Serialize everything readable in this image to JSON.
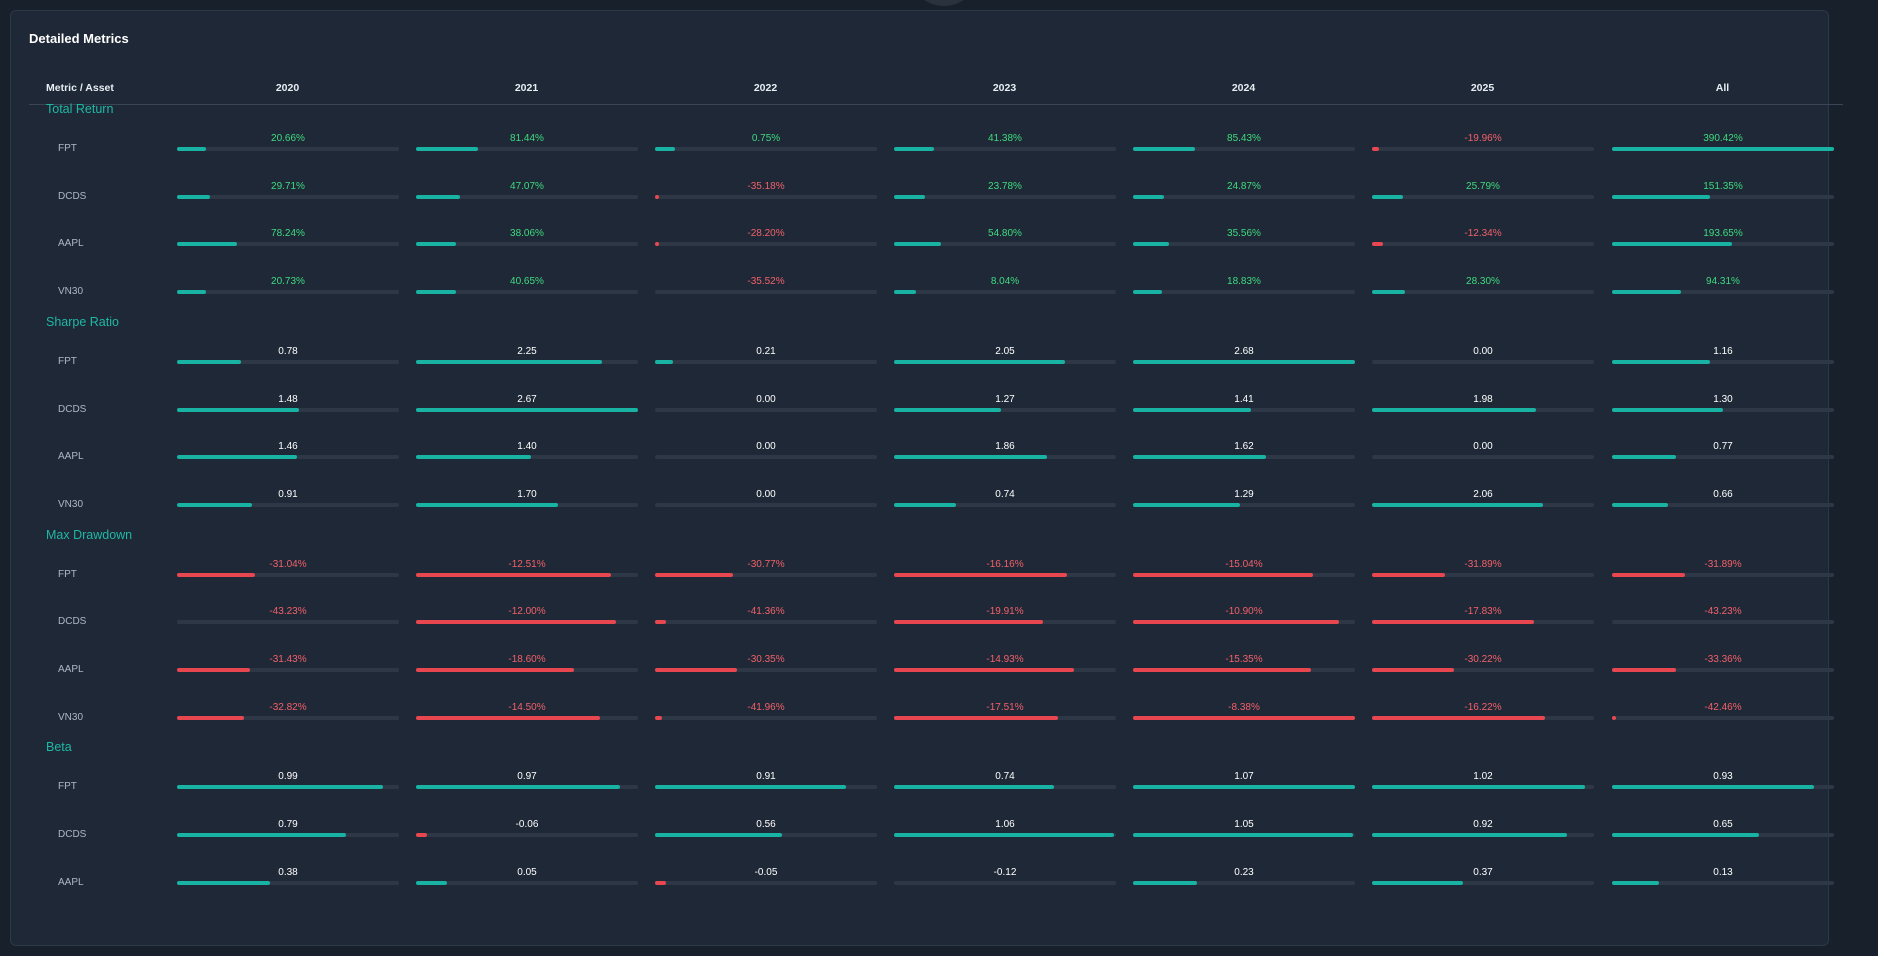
{
  "title": "Detailed Metrics",
  "columns": [
    "Metric / Asset",
    "2020",
    "2021",
    "2022",
    "2023",
    "2024",
    "2025",
    "All"
  ],
  "colors": {
    "positive": "#18b3a2",
    "negative": "#e84750",
    "text_green": "#3fdb7f",
    "text_red": "#f2616a",
    "section": "#1eb8a6"
  },
  "sections": [
    {
      "title": "Total Return",
      "rows": [
        {
          "asset": "FPT",
          "values": [
            "20.66%",
            "81.44%",
            "0.75%",
            "41.38%",
            "85.43%",
            "-19.96%",
            "390.42%"
          ],
          "bars": [
            0.13,
            0.28,
            0.09,
            0.18,
            0.28,
            0.03,
            1.0
          ],
          "signs": [
            "pos",
            "pos",
            "pos",
            "pos",
            "pos",
            "neg",
            "pos"
          ]
        },
        {
          "asset": "DCDS",
          "values": [
            "29.71%",
            "47.07%",
            "-35.18%",
            "23.78%",
            "24.87%",
            "25.79%",
            "151.35%"
          ],
          "bars": [
            0.15,
            0.2,
            0.005,
            0.14,
            0.14,
            0.14,
            0.44
          ],
          "signs": [
            "pos",
            "pos",
            "neg",
            "pos",
            "pos",
            "pos",
            "pos"
          ]
        },
        {
          "asset": "AAPL",
          "values": [
            "78.24%",
            "38.06%",
            "-28.20%",
            "54.80%",
            "35.56%",
            "-12.34%",
            "193.65%"
          ],
          "bars": [
            0.27,
            0.18,
            0.015,
            0.21,
            0.16,
            0.05,
            0.54
          ],
          "signs": [
            "pos",
            "pos",
            "neg",
            "pos",
            "pos",
            "neg",
            "pos"
          ]
        },
        {
          "asset": "VN30",
          "values": [
            "20.73%",
            "40.65%",
            "-35.52%",
            "8.04%",
            "18.83%",
            "28.30%",
            "94.31%"
          ],
          "bars": [
            0.13,
            0.18,
            0.0,
            0.1,
            0.13,
            0.15,
            0.31
          ],
          "signs": [
            "pos",
            "pos",
            "neg",
            "pos",
            "pos",
            "pos",
            "pos"
          ]
        }
      ]
    },
    {
      "title": "Sharpe Ratio",
      "rows": [
        {
          "asset": "FPT",
          "values": [
            "0.78",
            "2.25",
            "0.21",
            "2.05",
            "2.68",
            "0.00",
            "1.16"
          ],
          "bars": [
            0.29,
            0.84,
            0.08,
            0.77,
            1.0,
            0.0,
            0.44
          ],
          "signs": [
            "pos",
            "pos",
            "pos",
            "pos",
            "pos",
            "pos",
            "pos"
          ]
        },
        {
          "asset": "DCDS",
          "values": [
            "1.48",
            "2.67",
            "0.00",
            "1.27",
            "1.41",
            "1.98",
            "1.30"
          ],
          "bars": [
            0.55,
            1.0,
            0.0,
            0.48,
            0.53,
            0.74,
            0.5
          ],
          "signs": [
            "pos",
            "pos",
            "pos",
            "pos",
            "pos",
            "pos",
            "pos"
          ]
        },
        {
          "asset": "AAPL",
          "values": [
            "1.46",
            "1.40",
            "0.00",
            "1.86",
            "1.62",
            "0.00",
            "0.77"
          ],
          "bars": [
            0.54,
            0.52,
            0.0,
            0.69,
            0.6,
            0.0,
            0.29
          ],
          "signs": [
            "pos",
            "pos",
            "pos",
            "pos",
            "pos",
            "pos",
            "pos"
          ]
        },
        {
          "asset": "VN30",
          "values": [
            "0.91",
            "1.70",
            "0.00",
            "0.74",
            "1.29",
            "2.06",
            "0.66"
          ],
          "bars": [
            0.34,
            0.64,
            0.0,
            0.28,
            0.48,
            0.77,
            0.25
          ],
          "signs": [
            "pos",
            "pos",
            "pos",
            "pos",
            "pos",
            "pos",
            "pos"
          ]
        }
      ]
    },
    {
      "title": "Max Drawdown",
      "rows": [
        {
          "asset": "FPT",
          "values": [
            "-31.04%",
            "-12.51%",
            "-30.77%",
            "-16.16%",
            "-15.04%",
            "-31.89%",
            "-31.89%"
          ],
          "bars": [
            0.35,
            0.88,
            0.35,
            0.78,
            0.81,
            0.33,
            0.33
          ],
          "signs": [
            "neg",
            "neg",
            "neg",
            "neg",
            "neg",
            "neg",
            "neg"
          ]
        },
        {
          "asset": "DCDS",
          "values": [
            "-43.23%",
            "-12.00%",
            "-41.36%",
            "-19.91%",
            "-10.90%",
            "-17.83%",
            "-43.23%"
          ],
          "bars": [
            0.0,
            0.9,
            0.05,
            0.67,
            0.93,
            0.73,
            0.0
          ],
          "signs": [
            "neg",
            "neg",
            "neg",
            "neg",
            "neg",
            "neg",
            "neg"
          ]
        },
        {
          "asset": "AAPL",
          "values": [
            "-31.43%",
            "-18.60%",
            "-30.35%",
            "-14.93%",
            "-15.35%",
            "-30.22%",
            "-33.36%"
          ],
          "bars": [
            0.33,
            0.71,
            0.37,
            0.81,
            0.8,
            0.37,
            0.29
          ],
          "signs": [
            "neg",
            "neg",
            "neg",
            "neg",
            "neg",
            "neg",
            "neg"
          ]
        },
        {
          "asset": "VN30",
          "values": [
            "-32.82%",
            "-14.50%",
            "-41.96%",
            "-17.51%",
            "-8.38%",
            "-16.22%",
            "-42.46%"
          ],
          "bars": [
            0.3,
            0.83,
            0.03,
            0.74,
            1.0,
            0.78,
            0.01
          ],
          "signs": [
            "neg",
            "neg",
            "neg",
            "neg",
            "neg",
            "neg",
            "neg"
          ]
        }
      ]
    },
    {
      "title": "Beta",
      "rows": [
        {
          "asset": "FPT",
          "values": [
            "0.99",
            "0.97",
            "0.91",
            "0.74",
            "1.07",
            "1.02",
            "0.93"
          ],
          "bars": [
            0.93,
            0.92,
            0.86,
            0.72,
            1.0,
            0.96,
            0.91
          ],
          "signs": [
            "pos",
            "pos",
            "pos",
            "pos",
            "pos",
            "pos",
            "pos"
          ]
        },
        {
          "asset": "DCDS",
          "values": [
            "0.79",
            "-0.06",
            "0.56",
            "1.06",
            "1.05",
            "0.92",
            "0.65"
          ],
          "bars": [
            0.76,
            0.05,
            0.57,
            0.99,
            0.99,
            0.88,
            0.66
          ],
          "signs": [
            "pos",
            "neg",
            "pos",
            "pos",
            "pos",
            "pos",
            "pos"
          ]
        },
        {
          "asset": "AAPL",
          "values": [
            "0.38",
            "0.05",
            "-0.05",
            "-0.12",
            "0.23",
            "0.37",
            "0.13"
          ],
          "bars": [
            0.42,
            0.14,
            0.05,
            0.0,
            0.29,
            0.41,
            0.21
          ],
          "signs": [
            "pos",
            "pos",
            "neg",
            "neg",
            "pos",
            "pos",
            "pos"
          ]
        }
      ]
    }
  ]
}
